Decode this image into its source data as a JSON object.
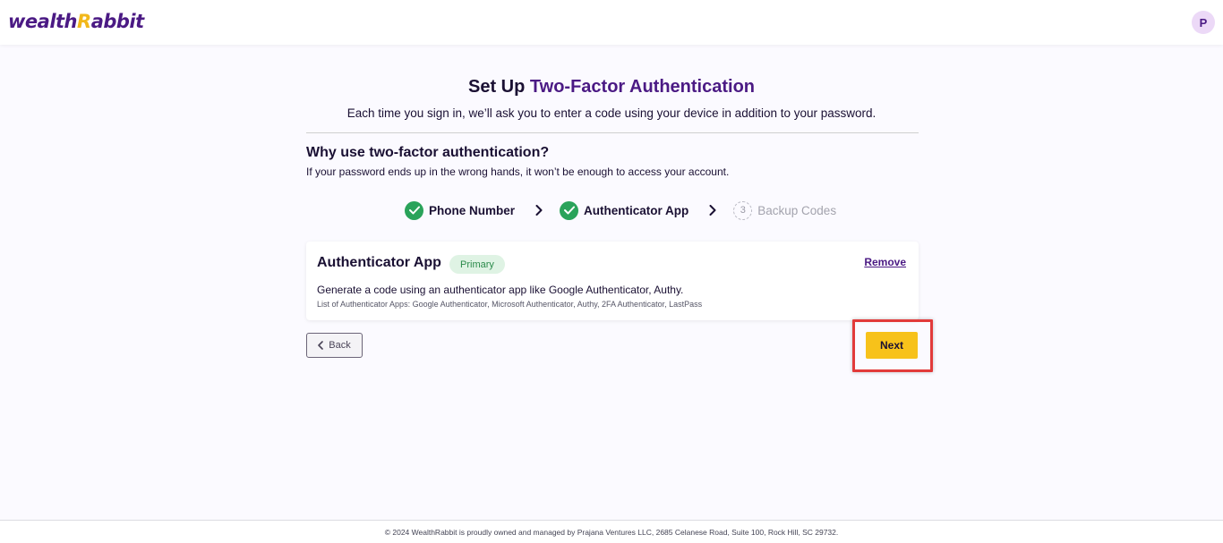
{
  "header": {
    "logo_prefix": "wealth",
    "logo_r": "R",
    "logo_suffix": "abbit",
    "avatar_initial": "P"
  },
  "page": {
    "title_plain": "Set Up ",
    "title_accent": "Two-Factor Authentication",
    "subtitle": "Each time you sign in, we’ll ask you to enter a code using your device in addition to your password.",
    "why_heading": "Why use two-factor authentication?",
    "why_text": "If your password ends up in the wrong hands, it won’t be enough to access your account."
  },
  "stepper": {
    "steps": [
      {
        "label": "Phone Number",
        "status": "complete"
      },
      {
        "label": "Authenticator App",
        "status": "complete"
      },
      {
        "number": "3",
        "label": "Backup Codes",
        "status": "pending"
      }
    ]
  },
  "card": {
    "title": "Authenticator App",
    "badge": "Primary",
    "remove_label": "Remove",
    "description": "Generate a code using an authenticator app like Google Authenticator, Authy.",
    "apps_list": "List of Authenticator Apps: Google Authenticator, Microsoft Authenticator, Authy, 2FA Authenticator, LastPass"
  },
  "actions": {
    "back_label": "Back",
    "next_label": "Next"
  },
  "footer": {
    "text": "© 2024 WealthRabbit is proudly owned and managed by Prajana Ventures LLC, 2685 Celanese Road, Suite 100, Rock Hill, SC 29732."
  },
  "colors": {
    "brand_purple": "#4b1a84",
    "brand_yellow": "#f7c21a",
    "success_green": "#2aa35a",
    "highlight_red": "#e23a3a"
  }
}
